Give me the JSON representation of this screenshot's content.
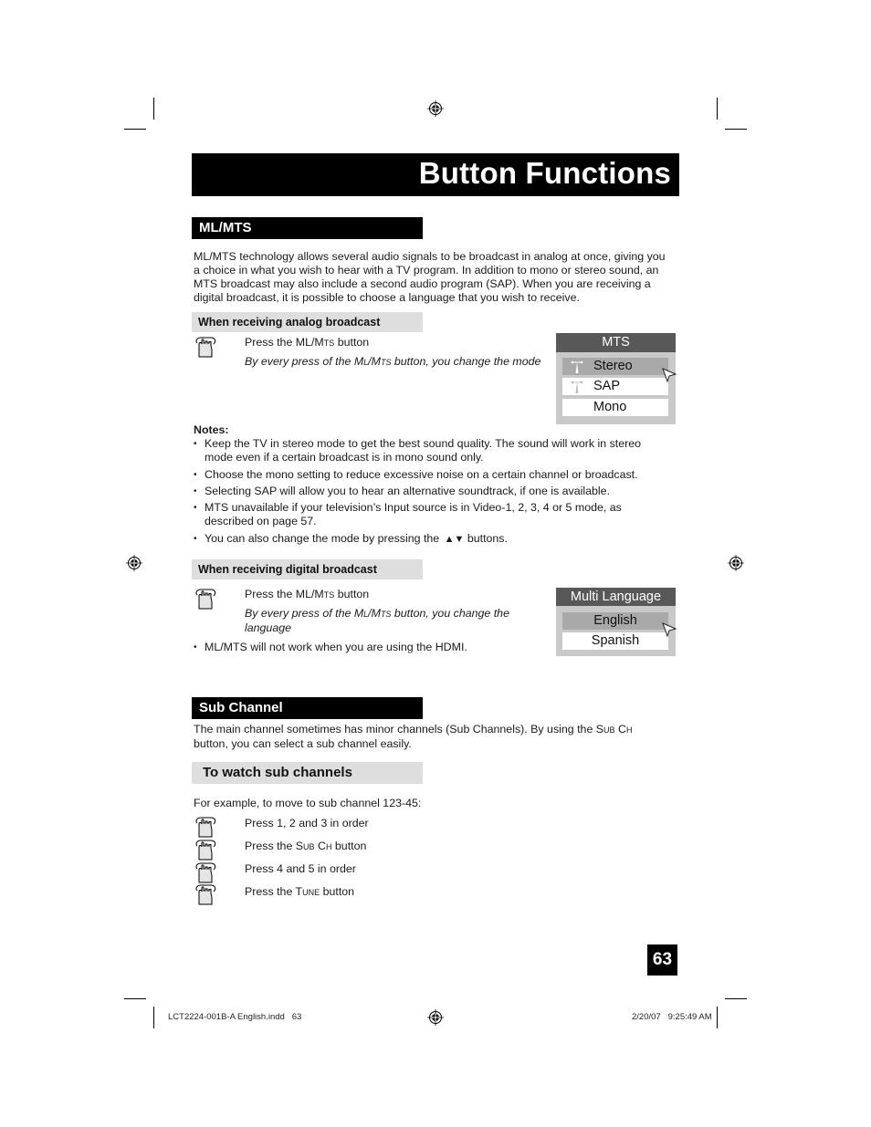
{
  "page": {
    "title": "Button Functions",
    "page_number": "63"
  },
  "ml_mts": {
    "heading": "ML/MTS",
    "intro_lines": [
      "ML/MTS technology allows several audio signals to be broadcast in analog at once, giving you",
      "a choice in what you wish to hear with a TV program. In addition to mono or stereo sound, an",
      "MTS broadcast may also include a second audio program (SAP).  When you are receiving a",
      "digital broadcast, it is possible to choose a language that you wish to receive."
    ],
    "analog": {
      "heading": "When receiving analog broadcast",
      "step_prefix": "Press the ML/M",
      "step_sc": "TS",
      "step_suffix": " button",
      "desc_prefix": "By every press of the M",
      "desc_sc1": "L",
      "desc_mid": "/M",
      "desc_sc2": "TS",
      "desc_suffix": " button, you change the mode",
      "osd": {
        "title": "MTS",
        "items": [
          {
            "label": "Stereo",
            "icon": "antenna-icon",
            "selected": true
          },
          {
            "label": "SAP",
            "icon": "antenna-icon",
            "selected": false
          },
          {
            "label": "Mono",
            "icon": "",
            "selected": false
          }
        ]
      }
    },
    "notes": {
      "label": "Notes:",
      "items": [
        {
          "line1": "Keep the TV in stereo mode to get the best sound quality. The sound will work in stereo",
          "line2": "mode even if a certain broadcast is in mono sound only."
        },
        {
          "line1": "Choose the mono setting to reduce excessive noise on a certain channel or broadcast.",
          "line2": ""
        },
        {
          "line1": "Selecting SAP will allow you to hear an alternative soundtrack, if one is available.",
          "line2": ""
        },
        {
          "line1": "MTS unavailable if your television’s Input source is in Video-1, 2, 3, 4 or 5 mode, as",
          "line2": "described on page 57."
        }
      ],
      "arrows_prefix": "You can also change the mode by pressing the ",
      "arrows_glyph": "▲▼",
      "arrows_suffix": " buttons."
    },
    "digital": {
      "heading": "When receiving digital broadcast",
      "step_prefix": "Press the ML/M",
      "step_sc": "TS",
      "step_suffix": " button",
      "desc_line1_prefix": "By every press of the M",
      "desc_sc1": "L",
      "desc_mid": "/M",
      "desc_sc2": "TS",
      "desc_line1_suffix": " button, you change the",
      "desc_line2": "language",
      "note": "ML/MTS will not work when you are using the HDMI.",
      "osd": {
        "title": "Multi Language",
        "items": [
          {
            "label": "English",
            "selected": true
          },
          {
            "label": "Spanish",
            "selected": false
          }
        ]
      }
    }
  },
  "sub_channel": {
    "heading": "Sub Channel",
    "intro_line1_prefix": "The main channel sometimes has minor channels (Sub Channels).  By using the S",
    "intro_sc1": "UB",
    "intro_mid": " C",
    "intro_sc2": "H",
    "intro_line2": "button, you can select a sub channel easily.",
    "watch": {
      "heading": "To watch sub channels",
      "example": "For example, to move to sub channel 123-45:",
      "steps": [
        {
          "prefix": "Press 1, 2 and 3 in order",
          "sc1": "",
          "mid": "",
          "sc2": "",
          "suffix": ""
        },
        {
          "prefix": "Press the S",
          "sc1": "UB",
          "mid": " C",
          "sc2": "H",
          "suffix": " button"
        },
        {
          "prefix": "Press 4 and 5 in order",
          "sc1": "",
          "mid": "",
          "sc2": "",
          "suffix": ""
        },
        {
          "prefix": "Press the T",
          "sc1": "UNE",
          "mid": "",
          "sc2": "",
          "suffix": " button"
        }
      ]
    }
  },
  "footer": {
    "file": "LCT2224-001B-A English.indd   63",
    "timestamp": "2/20/07   9:25:49 AM"
  },
  "colors": {
    "header_bg": "#000000",
    "subheader_bg": "#dedede",
    "osd_title_bg": "#585858",
    "osd_bg": "#c9c9c9",
    "osd_selected": "#a9a9a9"
  }
}
